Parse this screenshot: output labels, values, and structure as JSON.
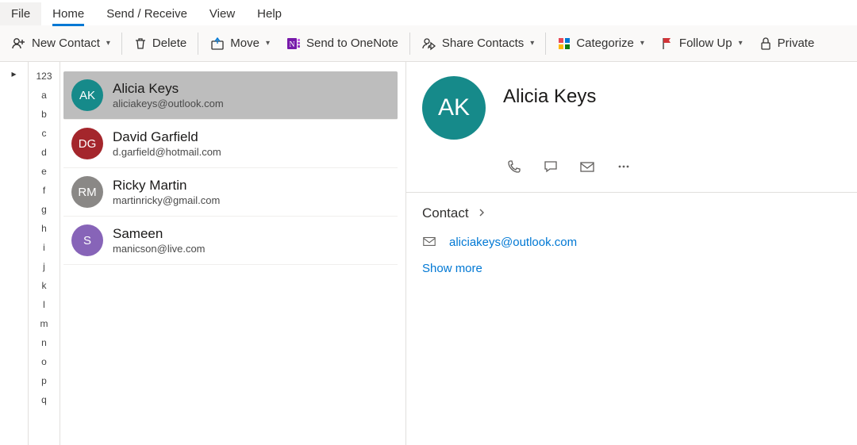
{
  "menu": {
    "file": "File",
    "home": "Home",
    "send_receive": "Send / Receive",
    "view": "View",
    "help": "Help",
    "active": "home"
  },
  "ribbon": {
    "new_contact": "New Contact",
    "delete": "Delete",
    "move": "Move",
    "send_onenote": "Send to OneNote",
    "share_contacts": "Share Contacts",
    "categorize": "Categorize",
    "follow_up": "Follow Up",
    "private": "Private"
  },
  "alpha_index": [
    "123",
    "a",
    "b",
    "c",
    "d",
    "e",
    "f",
    "g",
    "h",
    "i",
    "j",
    "k",
    "l",
    "m",
    "n",
    "o",
    "p",
    "q"
  ],
  "contacts": [
    {
      "initials": "AK",
      "name": "Alicia Keys",
      "email": "aliciakeys@outlook.com",
      "color": "#168a8a",
      "selected": true
    },
    {
      "initials": "DG",
      "name": "David Garfield",
      "email": "d.garfield@hotmail.com",
      "color": "#a4262c",
      "selected": false
    },
    {
      "initials": "RM",
      "name": "Ricky Martin",
      "email": "martinricky@gmail.com",
      "color": "#8a8886",
      "selected": false
    },
    {
      "initials": "S",
      "name": "Sameen",
      "email": "manicson@live.com",
      "color": "#8764b8",
      "selected": false
    }
  ],
  "detail": {
    "initials": "AK",
    "name": "Alicia Keys",
    "avatar_color": "#168a8a",
    "section_title": "Contact",
    "email": "aliciakeys@outlook.com",
    "show_more": "Show more"
  }
}
